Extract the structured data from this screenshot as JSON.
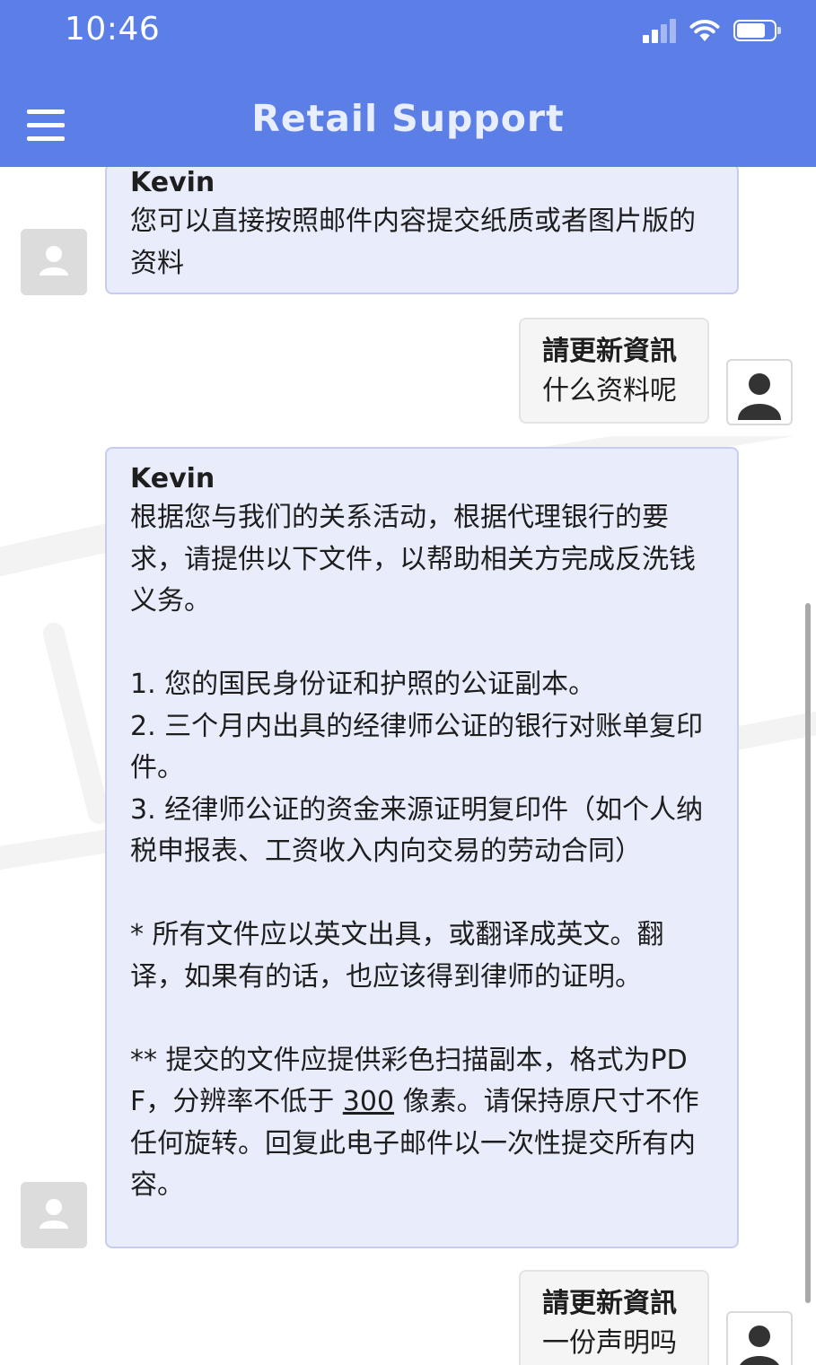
{
  "status_bar": {
    "time": "10:46"
  },
  "header": {
    "title": "Retail Support"
  },
  "messages": [
    {
      "sender": "Kevin",
      "text": "您可以直接按照邮件内容提交纸质或者图片版的资料"
    },
    {
      "sender": "請更新資訊",
      "text": "什么资料呢"
    },
    {
      "sender": "Kevin",
      "text_part1": "根据您与我们的关系活动，根据代理银行的要求，请提供以下文件，以帮助相关方完成反洗钱义务。\n\n1. 您的国民身份证和护照的公证副本。\n2. 三个月内出具的经律师公证的银行对账单复印件。\n3. 经律师公证的资金来源证明复印件（如个人纳税申报表、工资收入内向交易的劳动合同）\n\n* 所有文件应以英文出具，或翻译成英文。翻译，如果有的话，也应该得到律师的证明。\n\n** 提交的文件应提供彩色扫描副本，格式为PDF，分辨率不低于 ",
      "link_text": "300",
      "text_part2": " 像素。请保持原尺寸不作任何旋转。回复此电子邮件以一次性提交所有内容。"
    },
    {
      "sender": "請更新資訊",
      "text": "一份声明吗"
    }
  ]
}
